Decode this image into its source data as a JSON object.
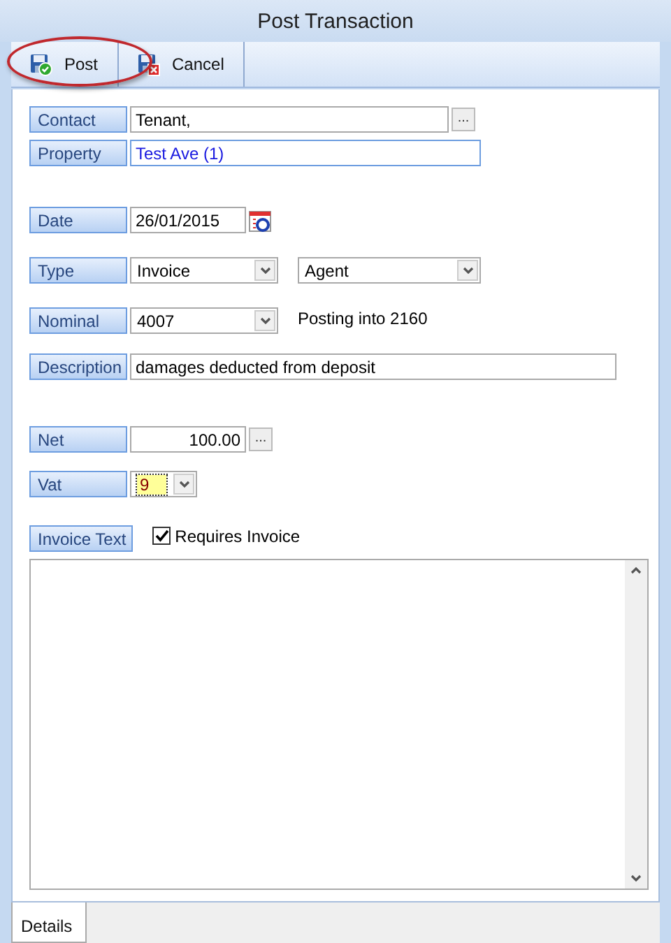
{
  "window": {
    "title": "Post Transaction"
  },
  "toolbar": [
    {
      "label": "Post",
      "kind": "post"
    },
    {
      "label": "Cancel",
      "kind": "cancel"
    }
  ],
  "fields": [
    {
      "kind": "text",
      "label": "Contact",
      "value": "Tenant,",
      "browse": "..."
    },
    {
      "kind": "link",
      "label": "Property",
      "value": "Test Ave (1)"
    },
    {
      "kind": "date",
      "label": "Date",
      "value": "26/01/2015"
    },
    {
      "kind": "select",
      "label": "Type",
      "value": "Invoice",
      "second": "Agent"
    },
    {
      "kind": "select",
      "label": "Nominal",
      "value": "4007",
      "note": "Posting into 2160"
    },
    {
      "kind": "text",
      "label": "Description",
      "value": "damages deducted from deposit"
    },
    {
      "kind": "number",
      "label": "Net",
      "value": "100.00",
      "browse": "..."
    },
    {
      "kind": "select",
      "label": "Vat",
      "value": "9",
      "focused": true
    },
    {
      "kind": "check",
      "label": "Invoice Text",
      "check_label": "Requires Invoice",
      "checked": true
    }
  ],
  "tabs": [
    {
      "label": "Details",
      "selected": true
    }
  ]
}
